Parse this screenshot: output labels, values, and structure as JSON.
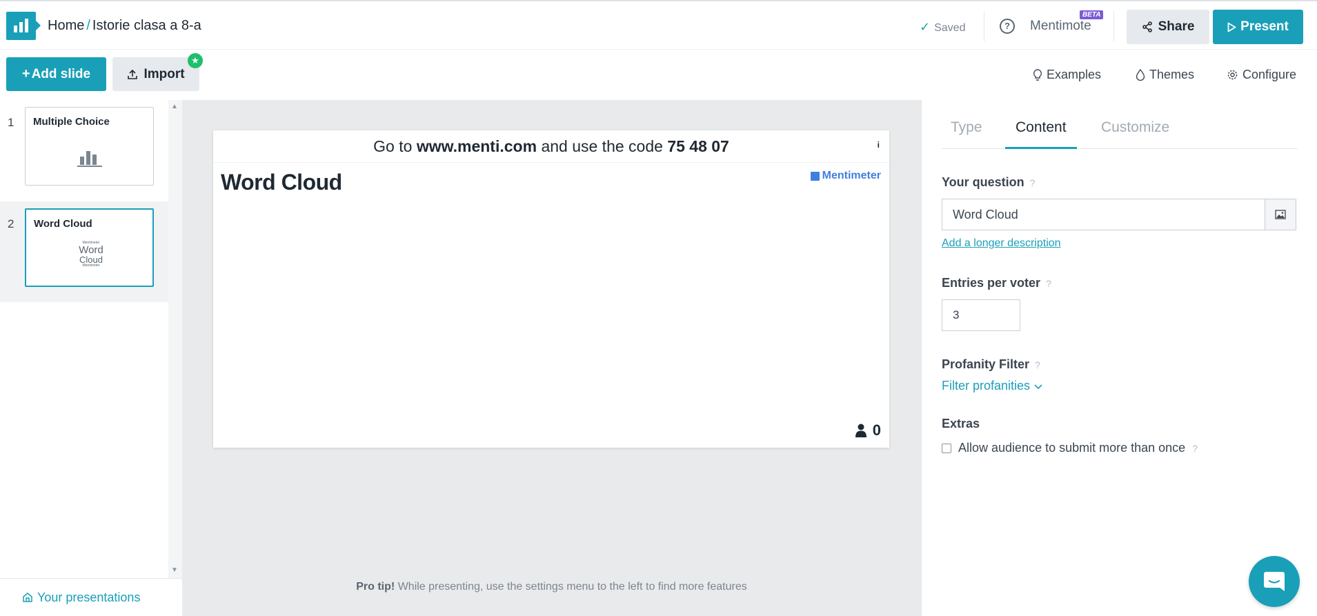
{
  "header": {
    "home": "Home",
    "separator": "/",
    "presentation_title": "Istorie clasa a 8-a",
    "saved": "Saved",
    "mentimote": "Mentimote",
    "beta": "BETA",
    "share": "Share",
    "present": "Present"
  },
  "toolbar": {
    "add_slide": "Add slide",
    "import": "Import",
    "examples": "Examples",
    "themes": "Themes",
    "configure": "Configure"
  },
  "slides": [
    {
      "number": "1",
      "title": "Multiple Choice"
    },
    {
      "number": "2",
      "title": "Word Cloud",
      "thumb_words": [
        "Mentimeter",
        "Word",
        "Cloud",
        "Mentimeter"
      ]
    }
  ],
  "sidebar": {
    "your_presentations": "Your presentations"
  },
  "canvas": {
    "join_prefix": "Go to",
    "join_url": "www.menti.com",
    "join_middle": "and use the code",
    "join_code": "75 48 07",
    "info": "i",
    "question": "Word Cloud",
    "brand": "Mentimeter",
    "participants": "0",
    "protip_bold": "Pro tip!",
    "protip_text": "While presenting, use the settings menu to the left to find more features"
  },
  "panel": {
    "tabs": [
      "Type",
      "Content",
      "Customize"
    ],
    "active_tab": "Content",
    "question_label": "Your question",
    "question_value": "Word Cloud",
    "longer_description": "Add a longer description",
    "entries_label": "Entries per voter",
    "entries_value": "3",
    "profanity_label": "Profanity Filter",
    "profanity_value": "Filter profanities",
    "extras_label": "Extras",
    "extras_checkbox": "Allow audience to submit more than once",
    "help_mark": "?"
  },
  "colors": {
    "accent": "#1a9fb8",
    "brand_blue": "#3f7fe0",
    "beta_purple": "#7a5bd6",
    "badge_green": "#1fbf6b"
  }
}
